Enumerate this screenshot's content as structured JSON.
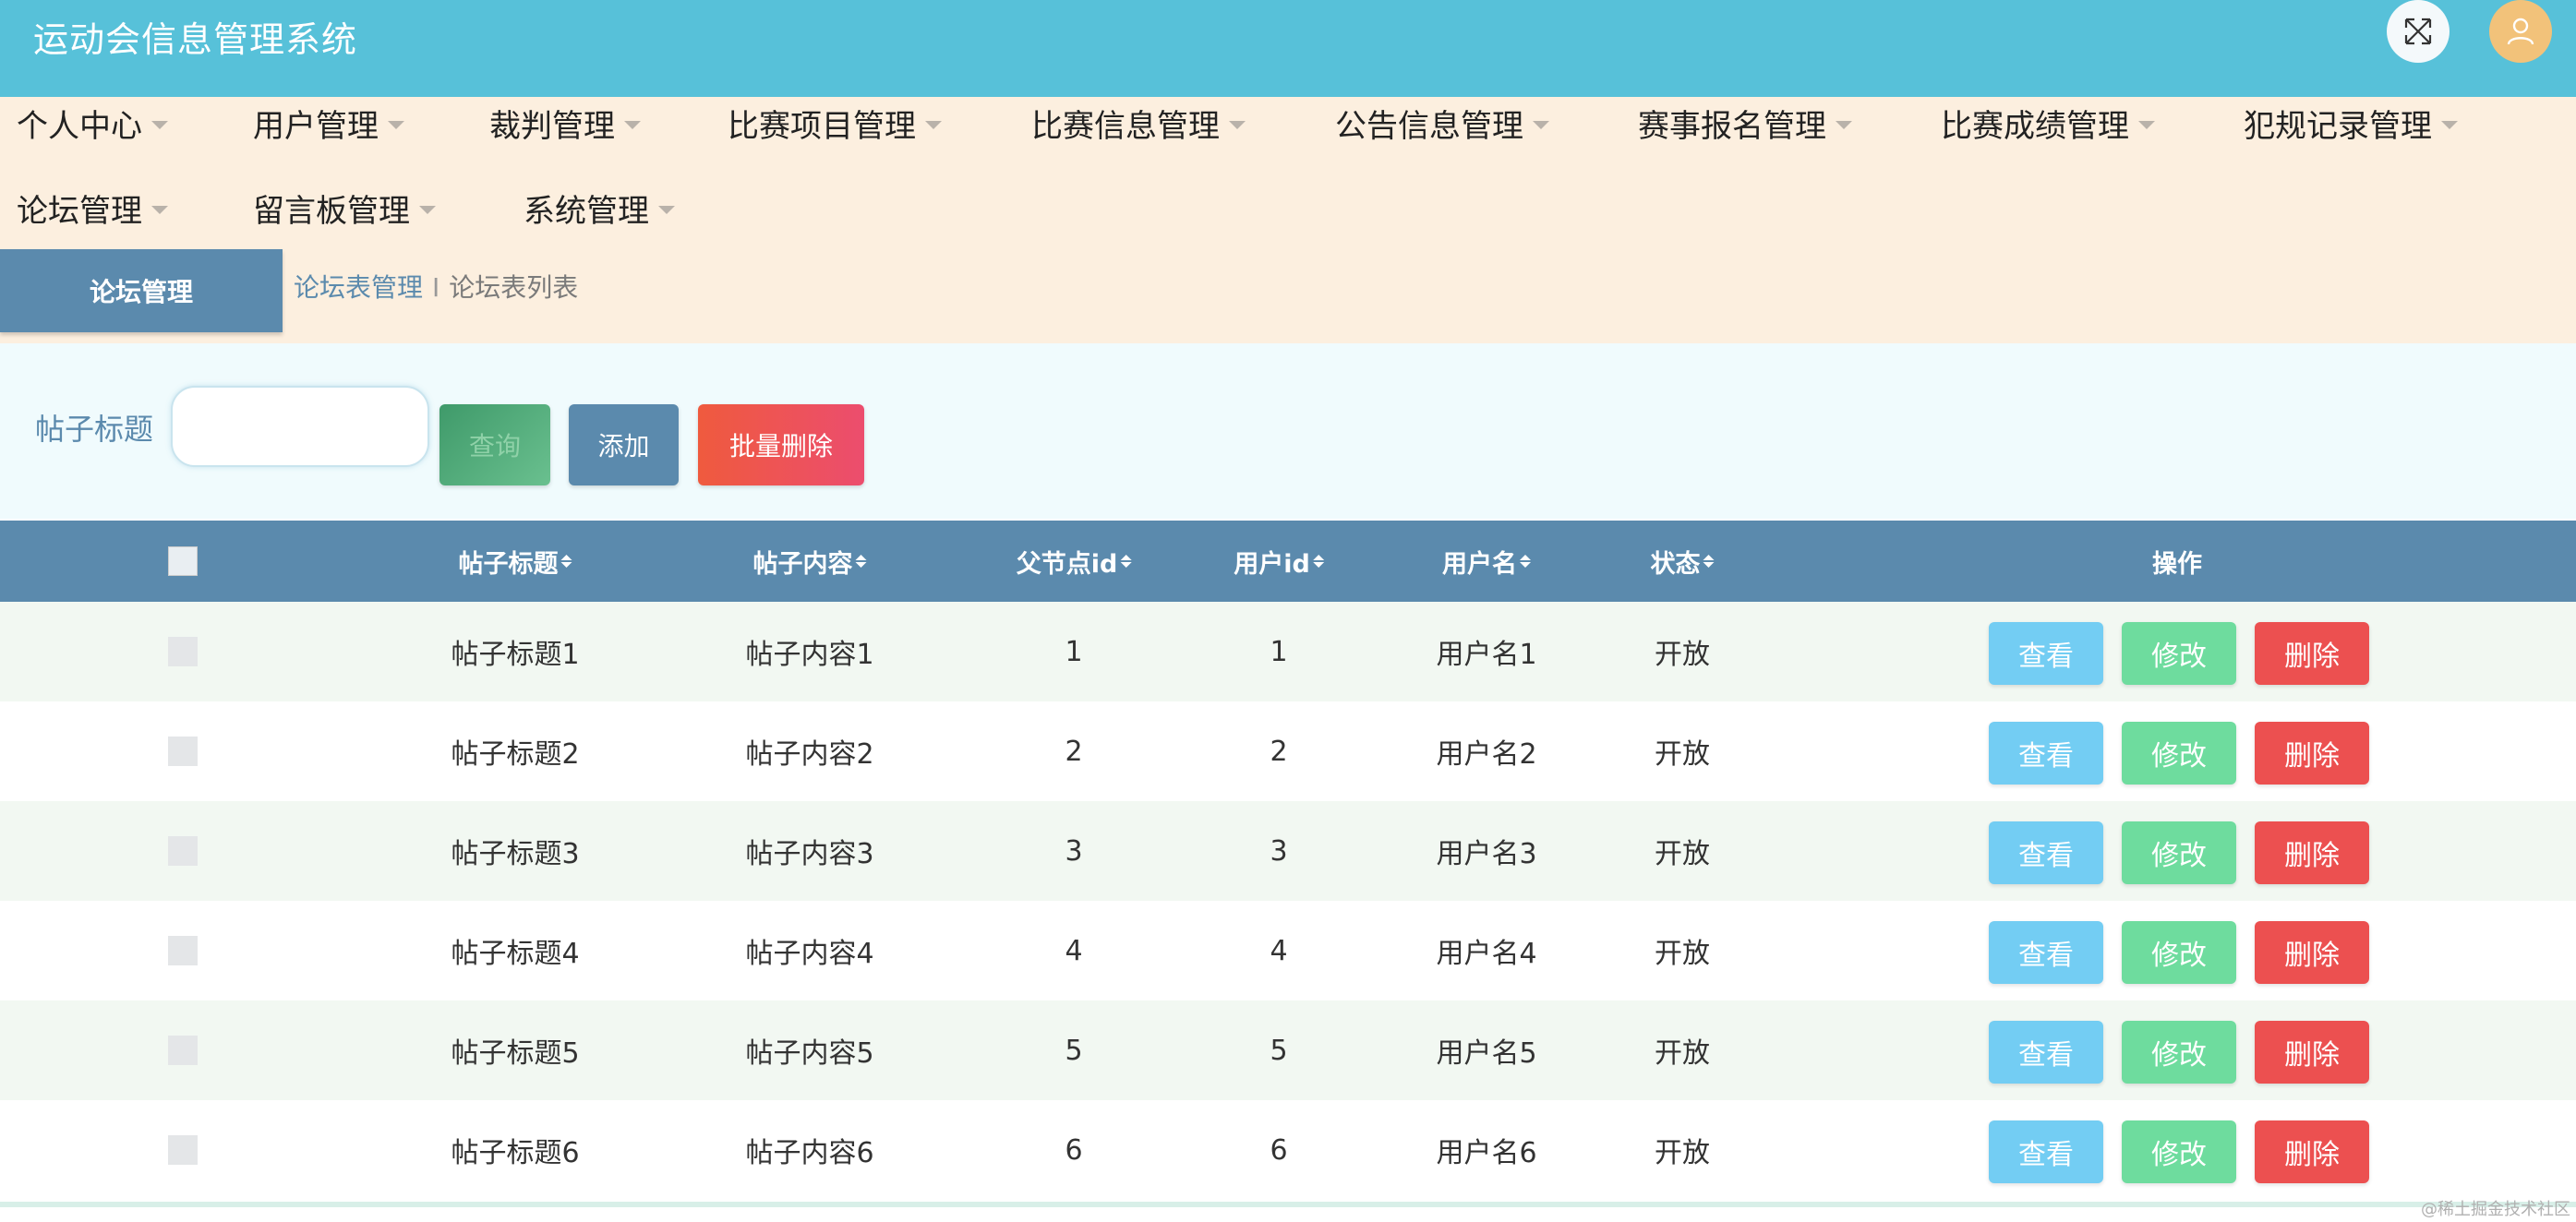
{
  "header": {
    "title": "运动会信息管理系统",
    "fullscreen_icon": "expand-icon",
    "avatar_icon": "user-icon"
  },
  "nav": {
    "items": [
      {
        "label": "个人中心"
      },
      {
        "label": "用户管理"
      },
      {
        "label": "裁判管理"
      },
      {
        "label": "比赛项目管理"
      },
      {
        "label": "比赛信息管理"
      },
      {
        "label": "公告信息管理"
      },
      {
        "label": "赛事报名管理"
      },
      {
        "label": "比赛成绩管理"
      },
      {
        "label": "犯规记录管理"
      },
      {
        "label": "论坛管理"
      },
      {
        "label": "留言板管理"
      },
      {
        "label": "系统管理"
      }
    ]
  },
  "breadcrumb": {
    "section": "论坛管理",
    "parent": "论坛表管理",
    "separator": "I",
    "current": "论坛表列表"
  },
  "search": {
    "label": "帖子标题",
    "value": "",
    "placeholder": "",
    "query_label": "查询",
    "add_label": "添加",
    "batch_delete_label": "批量删除"
  },
  "table": {
    "columns": [
      "帖子标题",
      "帖子内容",
      "父节点id",
      "用户id",
      "用户名",
      "状态",
      "操作"
    ],
    "rows": [
      {
        "title": "帖子标题1",
        "content": "帖子内容1",
        "parent_id": "1",
        "user_id": "1",
        "username": "用户名1",
        "status": "开放"
      },
      {
        "title": "帖子标题2",
        "content": "帖子内容2",
        "parent_id": "2",
        "user_id": "2",
        "username": "用户名2",
        "status": "开放"
      },
      {
        "title": "帖子标题3",
        "content": "帖子内容3",
        "parent_id": "3",
        "user_id": "3",
        "username": "用户名3",
        "status": "开放"
      },
      {
        "title": "帖子标题4",
        "content": "帖子内容4",
        "parent_id": "4",
        "user_id": "4",
        "username": "用户名4",
        "status": "开放"
      },
      {
        "title": "帖子标题5",
        "content": "帖子内容5",
        "parent_id": "5",
        "user_id": "5",
        "username": "用户名5",
        "status": "开放"
      },
      {
        "title": "帖子标题6",
        "content": "帖子内容6",
        "parent_id": "6",
        "user_id": "6",
        "username": "用户名6",
        "status": "开放"
      }
    ],
    "actions": {
      "view": "查看",
      "edit": "修改",
      "delete": "删除"
    }
  },
  "watermark": "@稀土掘金技术社区",
  "colors": {
    "header_bg": "#57c1d9",
    "nav_bg": "#fcefdf",
    "primary": "#5b8aad",
    "view": "#73cdf3",
    "edit": "#6edc9e",
    "delete": "#ec5050"
  }
}
